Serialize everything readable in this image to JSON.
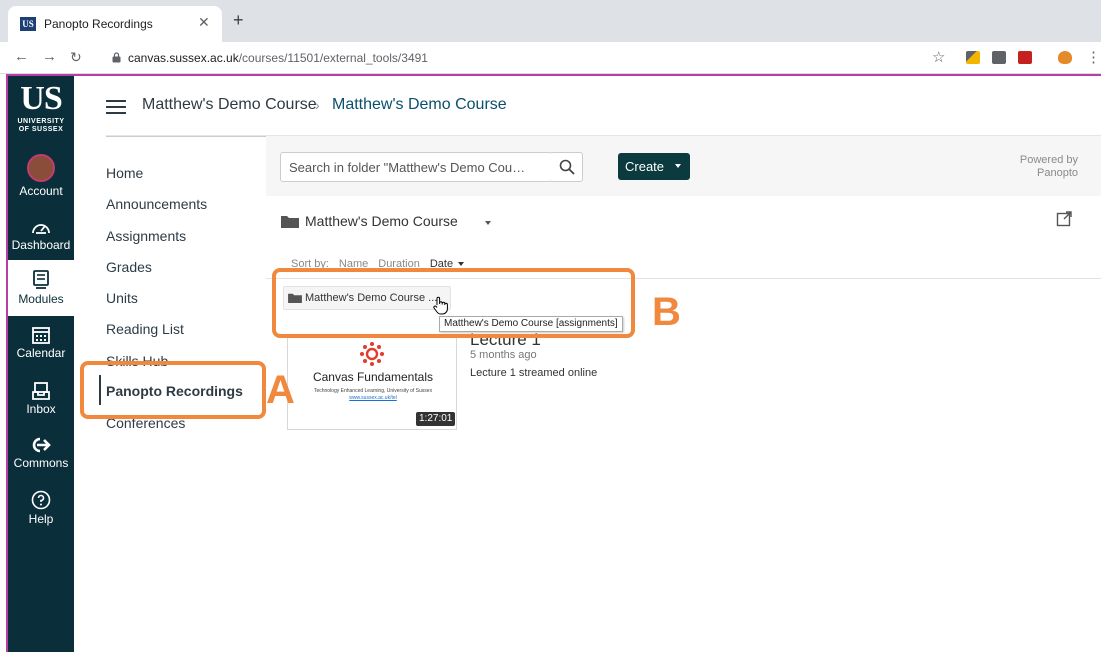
{
  "browser": {
    "tab_title": "Panopto Recordings",
    "tab_favicon": "US",
    "url_host": "canvas.sussex.ac.uk",
    "url_path": "/courses/11501/external_tools/3491"
  },
  "global_nav": {
    "logo_main": "US",
    "logo_line1": "UNIVERSITY",
    "logo_line2": "OF SUSSEX",
    "items": [
      {
        "label": "Account",
        "icon": "avatar"
      },
      {
        "label": "Dashboard",
        "icon": "dashboard-icon"
      },
      {
        "label": "Modules",
        "icon": "modules-icon"
      },
      {
        "label": "Calendar",
        "icon": "calendar-icon"
      },
      {
        "label": "Inbox",
        "icon": "inbox-icon"
      },
      {
        "label": "Commons",
        "icon": "commons-icon"
      },
      {
        "label": "Help",
        "icon": "help-icon"
      }
    ],
    "active": "Modules"
  },
  "header": {
    "breadcrumb_course": "Matthew's Demo Course",
    "breadcrumb_separator": "›",
    "breadcrumb_current": "Matthew's Demo Course"
  },
  "course_nav": {
    "items": [
      "Home",
      "Announcements",
      "Assignments",
      "Grades",
      "Units",
      "Reading List",
      "Skills Hub",
      "Panopto Recordings",
      "Conferences"
    ],
    "active": "Panopto Recordings"
  },
  "panopto": {
    "search_placeholder": "Search in folder \"Matthew's Demo Cou…",
    "create_label": "Create",
    "powered_by_line1": "Powered by",
    "powered_by_line2": "Panopto",
    "folder_name": "Matthew's Demo Course",
    "sort_by_label": "Sort by:",
    "sort_options": [
      "Name",
      "Duration",
      "Date"
    ],
    "sort_selected": "Date",
    "subfolder_name": "Matthew's Demo Course ...",
    "subfolder_tooltip": "Matthew's Demo Course [assignments]",
    "recording": {
      "title": "Lecture 1",
      "age": "5 months ago",
      "description": "Lecture 1 streamed online",
      "duration": "1:27:01",
      "thumb_title": "Canvas Fundamentals",
      "thumb_subtitle": "Technology Enhanced Learning, University of Sussex",
      "thumb_link": "www.sussex.ac.uk/tel"
    }
  },
  "annotations": {
    "label_a": "A",
    "label_b": "B",
    "color": "#f0883e"
  },
  "colors": {
    "global_nav_bg": "#0b2f3a",
    "create_button_bg": "#0b3a3f",
    "frame_accent": "#b73ea5",
    "breadcrumb_link": "#0b4f6c"
  }
}
